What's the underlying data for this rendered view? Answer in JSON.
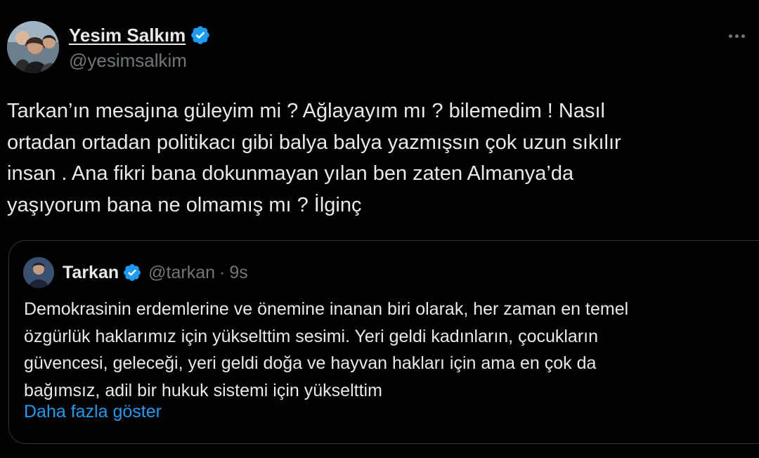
{
  "tweet": {
    "author": {
      "display_name": "Yesim Salkım",
      "handle": "@yesimsalkim",
      "verified_icon": "verified-badge-icon",
      "avatar": "avatar-photo"
    },
    "more_icon": "more-options-icon",
    "text": "Tarkan’ın mesajına güleyim mi ? Ağlayayım mı ? bilemedim ! Nasıl\nortadan ortadan politikacı gibi balya balya yazmışsın çok uzun sıkılır\ninsan . Ana fikri bana dokunmayan yılan ben zaten Almanya’da\nyaşıyorum bana ne olmamış mı ? İlginç",
    "quote": {
      "author": {
        "display_name": "Tarkan",
        "handle": "@tarkan",
        "separator": "·",
        "time": "9s",
        "verified_icon": "verified-badge-icon",
        "avatar": "avatar-photo"
      },
      "text": "Demokrasinin erdemlerine ve önemine inanan biri olarak, her zaman en temel\nözgürlük haklarımız için yükselttim sesimi. Yeri geldi kadınların, çocukların\ngüvencesi, geleceği, yeri geldi doğa ve hayvan hakları için ama en çok da\nbağımsız, adil bir hukuk sistemi için  yükselttim",
      "show_more_label": "Daha fazla göster"
    }
  },
  "colors": {
    "background": "#000000",
    "text_primary": "#e7e9ea",
    "text_secondary": "#71767b",
    "border": "#2f3336",
    "accent": "#1d9bf0"
  }
}
